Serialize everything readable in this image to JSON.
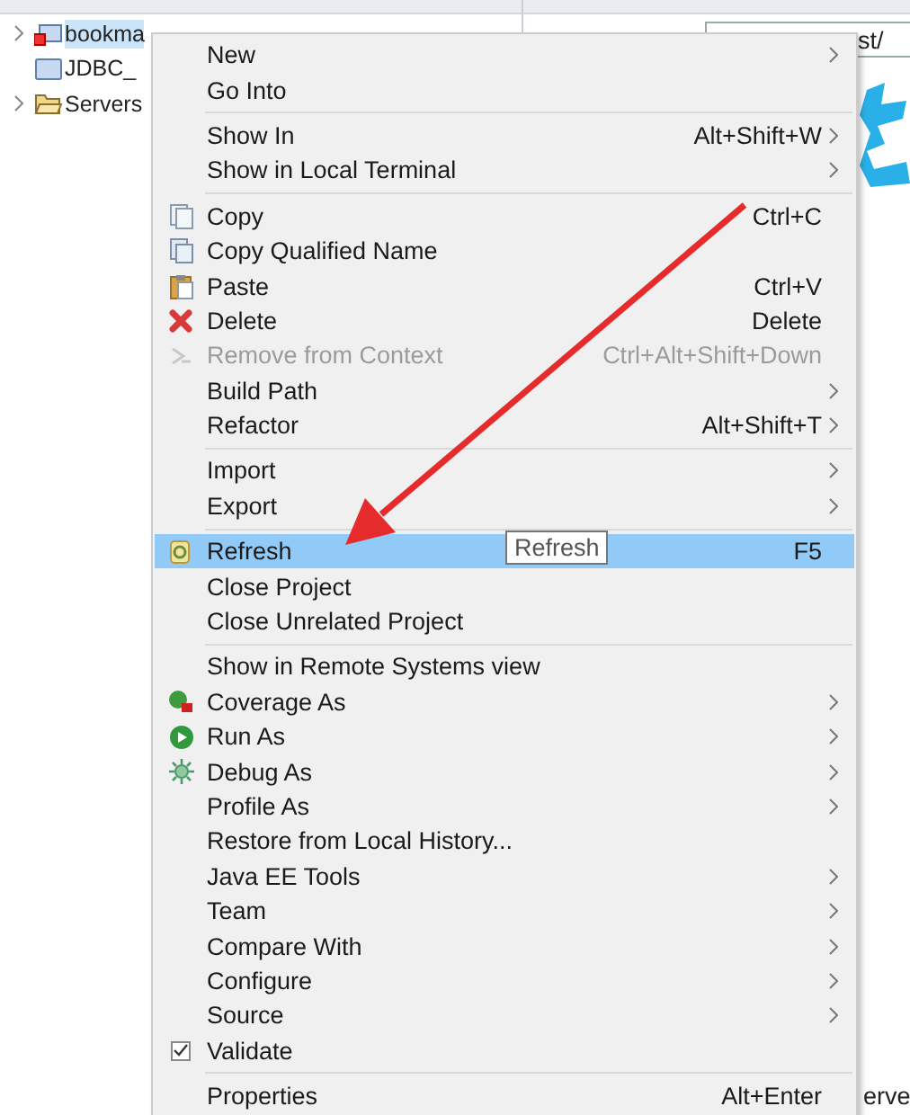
{
  "tree": {
    "items": [
      {
        "label": "bookma",
        "kind": "project",
        "selected": true,
        "expandable": true
      },
      {
        "label": "JDBC_",
        "kind": "folder",
        "selected": false,
        "expandable": false
      },
      {
        "label": "Servers",
        "kind": "open-folder",
        "selected": false,
        "expandable": true
      }
    ]
  },
  "editor": {
    "address": {
      "value": "st/"
    },
    "bottom_text": "erve"
  },
  "context_menu": {
    "groups": [
      [
        {
          "label": "New",
          "kind": "plain",
          "submenu": true,
          "disabled": false,
          "selected": false
        },
        {
          "label": "Go Into",
          "kind": "plain",
          "submenu": false,
          "disabled": false,
          "selected": false
        }
      ],
      [
        {
          "label": "Show In",
          "shortcut": "Alt+Shift+W",
          "kind": "plain",
          "submenu": true,
          "disabled": false,
          "selected": false
        },
        {
          "label": "Show in Local Terminal",
          "kind": "plain",
          "submenu": true,
          "disabled": false,
          "selected": false
        }
      ],
      [
        {
          "label": "Copy",
          "shortcut": "Ctrl+C",
          "kind": "copy",
          "submenu": false,
          "disabled": false,
          "selected": false
        },
        {
          "label": "Copy Qualified Name",
          "kind": "copy-name",
          "submenu": false,
          "disabled": false,
          "selected": false
        },
        {
          "label": "Paste",
          "shortcut": "Ctrl+V",
          "kind": "paste",
          "submenu": false,
          "disabled": false,
          "selected": false
        },
        {
          "label": "Delete",
          "shortcut": "Delete",
          "kind": "delete",
          "submenu": false,
          "disabled": false,
          "selected": false
        },
        {
          "label": "Remove from Context",
          "shortcut": "Ctrl+Alt+Shift+Down",
          "kind": "remove",
          "submenu": false,
          "disabled": true,
          "selected": false
        },
        {
          "label": "Build Path",
          "kind": "plain",
          "submenu": true,
          "disabled": false,
          "selected": false
        },
        {
          "label": "Refactor",
          "shortcut": "Alt+Shift+T",
          "kind": "plain",
          "submenu": true,
          "disabled": false,
          "selected": false
        }
      ],
      [
        {
          "label": "Import",
          "kind": "plain",
          "submenu": true,
          "disabled": false,
          "selected": false
        },
        {
          "label": "Export",
          "kind": "plain",
          "submenu": true,
          "disabled": false,
          "selected": false
        }
      ],
      [
        {
          "label": "Refresh",
          "shortcut": "F5",
          "kind": "refresh",
          "submenu": false,
          "disabled": false,
          "selected": true,
          "tooltip": "Refresh"
        },
        {
          "label": "Close Project",
          "kind": "plain",
          "submenu": false,
          "disabled": false,
          "selected": false
        },
        {
          "label": "Close Unrelated Project",
          "kind": "plain",
          "submenu": false,
          "disabled": false,
          "selected": false
        }
      ],
      [
        {
          "label": "Show in Remote Systems view",
          "kind": "plain",
          "submenu": false,
          "disabled": false,
          "selected": false
        },
        {
          "label": "Coverage As",
          "kind": "coverage",
          "submenu": true,
          "disabled": false,
          "selected": false
        },
        {
          "label": "Run As",
          "kind": "run",
          "submenu": true,
          "disabled": false,
          "selected": false
        },
        {
          "label": "Debug As",
          "kind": "debug",
          "submenu": true,
          "disabled": false,
          "selected": false
        },
        {
          "label": "Profile As",
          "kind": "plain",
          "submenu": true,
          "disabled": false,
          "selected": false
        },
        {
          "label": "Restore from Local History...",
          "kind": "plain",
          "submenu": false,
          "disabled": false,
          "selected": false
        },
        {
          "label": "Java EE Tools",
          "kind": "plain",
          "submenu": true,
          "disabled": false,
          "selected": false
        },
        {
          "label": "Team",
          "kind": "plain",
          "submenu": true,
          "disabled": false,
          "selected": false
        },
        {
          "label": "Compare With",
          "kind": "plain",
          "submenu": true,
          "disabled": false,
          "selected": false
        },
        {
          "label": "Configure",
          "kind": "plain",
          "submenu": true,
          "disabled": false,
          "selected": false
        },
        {
          "label": "Source",
          "kind": "plain",
          "submenu": true,
          "disabled": false,
          "selected": false
        },
        {
          "label": "Validate",
          "kind": "check",
          "checked": true,
          "submenu": false,
          "disabled": false,
          "selected": false
        }
      ],
      [
        {
          "label": "Properties",
          "shortcut": "Alt+Enter",
          "kind": "plain",
          "submenu": false,
          "disabled": false,
          "selected": false
        }
      ]
    ]
  }
}
